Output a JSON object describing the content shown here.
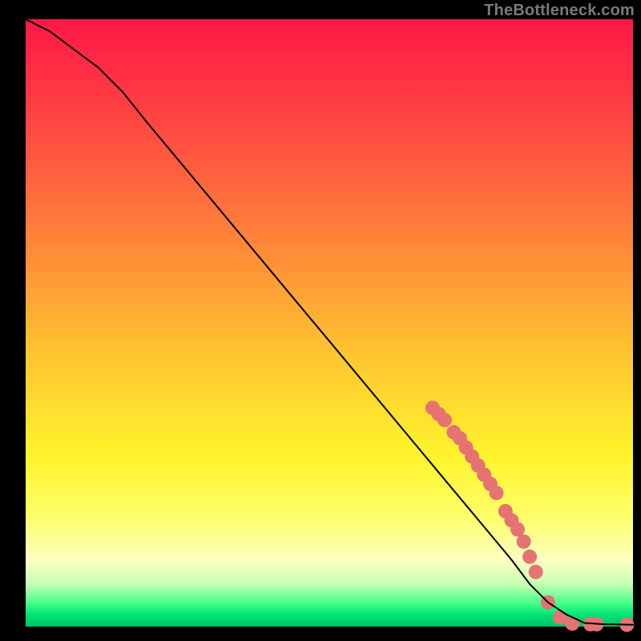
{
  "watermark": "TheBottleneck.com",
  "chart_data": {
    "type": "line",
    "title": "",
    "xlabel": "",
    "ylabel": "",
    "xlim": [
      0,
      100
    ],
    "ylim": [
      0,
      100
    ],
    "background_gradient": {
      "direction": "top-to-bottom",
      "stops": [
        {
          "pos": 0,
          "color": "#ff1846"
        },
        {
          "pos": 22,
          "color": "#ff5540"
        },
        {
          "pos": 55,
          "color": "#ffc430"
        },
        {
          "pos": 82,
          "color": "#fdff6a"
        },
        {
          "pos": 93,
          "color": "#c6ffb4"
        },
        {
          "pos": 100,
          "color": "#00c066"
        }
      ]
    },
    "series": [
      {
        "name": "bottleneck-curve",
        "color": "#000000",
        "stroke_width": 2,
        "x": [
          0,
          4,
          8,
          12,
          16,
          20,
          25,
          30,
          35,
          40,
          45,
          50,
          55,
          60,
          65,
          70,
          75,
          80,
          83,
          86,
          89,
          92,
          95,
          100
        ],
        "y": [
          100,
          98,
          95,
          92,
          88,
          83,
          77,
          71,
          65,
          59,
          53,
          47,
          41,
          35,
          29,
          23,
          17,
          11,
          7,
          4,
          2,
          0.6,
          0.4,
          0.3
        ]
      }
    ],
    "markers": {
      "name": "highlight-dots",
      "color": "#e57373",
      "radius": 9,
      "points": [
        {
          "x": 67,
          "y": 36
        },
        {
          "x": 68,
          "y": 35
        },
        {
          "x": 69,
          "y": 34
        },
        {
          "x": 70.5,
          "y": 32
        },
        {
          "x": 71.5,
          "y": 31
        },
        {
          "x": 72.5,
          "y": 29.5
        },
        {
          "x": 73.5,
          "y": 28
        },
        {
          "x": 74.5,
          "y": 26.5
        },
        {
          "x": 75.5,
          "y": 25
        },
        {
          "x": 76.5,
          "y": 23.5
        },
        {
          "x": 77.5,
          "y": 22
        },
        {
          "x": 79,
          "y": 19
        },
        {
          "x": 80,
          "y": 17.5
        },
        {
          "x": 81,
          "y": 16
        },
        {
          "x": 82,
          "y": 14
        },
        {
          "x": 83,
          "y": 11.5
        },
        {
          "x": 84,
          "y": 9
        },
        {
          "x": 86,
          "y": 4
        },
        {
          "x": 88,
          "y": 1.5
        },
        {
          "x": 90,
          "y": 0.5
        },
        {
          "x": 93,
          "y": 0.4
        },
        {
          "x": 94,
          "y": 0.4
        },
        {
          "x": 99,
          "y": 0.3
        }
      ]
    }
  }
}
